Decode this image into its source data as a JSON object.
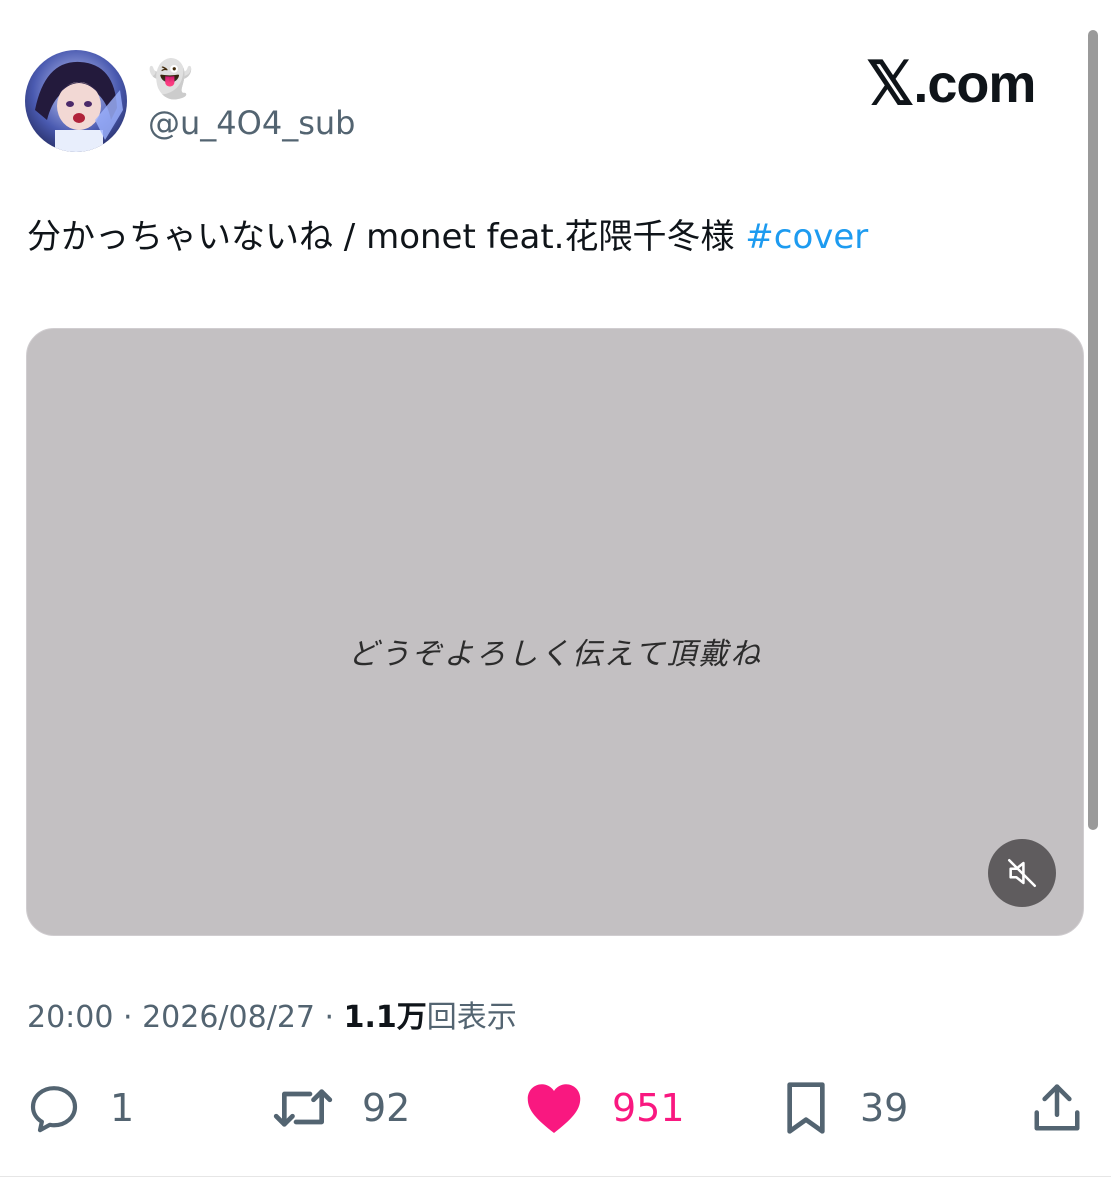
{
  "author": {
    "display_name": "👻",
    "handle": "@u_4O4_sub"
  },
  "site": {
    "logo_mark": "𝕏",
    "logo_text": ".com"
  },
  "tweet": {
    "text": "分かっちゃいないね / monet feat.花隈千冬様 ",
    "hashtag": "#cover"
  },
  "media": {
    "caption": "どうぞよろしく伝えて頂戴ね",
    "background_color": "#c3c0c2",
    "mute_icon": "speaker-muted-icon"
  },
  "meta": {
    "time": "20:00",
    "separator": " · ",
    "date": "2026/08/27",
    "views_count": "1.1万",
    "views_label": "回表示"
  },
  "actions": {
    "reply_count": "1",
    "retweet_count": "92",
    "like_count": "951",
    "bookmark_count": "39"
  },
  "colors": {
    "accent": "#1d9bf0",
    "like": "#f91880",
    "secondary_text": "#536471"
  }
}
